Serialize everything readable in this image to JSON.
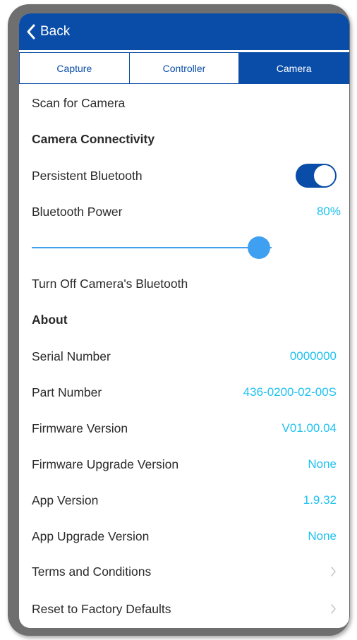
{
  "nav": {
    "back_label": "Back"
  },
  "tabs": [
    {
      "label": "Capture",
      "active": false
    },
    {
      "label": "Controller",
      "active": false
    },
    {
      "label": "Camera",
      "active": true
    }
  ],
  "rows": {
    "scan": "Scan for Camera",
    "connectivity_heading": "Camera Connectivity",
    "persistent_bt": "Persistent Bluetooth",
    "persistent_bt_on": true,
    "bt_power_label": "Bluetooth Power",
    "bt_power_value": "80%",
    "bt_power_fraction": 0.8,
    "turn_off_bt": "Turn Off Camera's Bluetooth",
    "about_heading": "About",
    "serial_label": "Serial Number",
    "serial_value": "0000000",
    "part_label": "Part Number",
    "part_value": "436-0200-02-00S",
    "firmware_label": "Firmware Version",
    "firmware_value": "V01.00.04",
    "fw_upgrade_label": "Firmware Upgrade Version",
    "fw_upgrade_value": "None",
    "app_label": "App Version",
    "app_value": "1.9.32",
    "app_upgrade_label": "App Upgrade Version",
    "app_upgrade_value": "None",
    "terms": "Terms and Conditions",
    "reset": "Reset to Factory Defaults"
  },
  "colors": {
    "brand": "#0a4da8",
    "value": "#1ec2f0",
    "slider": "#3f9ff0"
  },
  "icons": {
    "back": "chevron-left-icon",
    "row_chevron": "chevron-right-icon"
  }
}
